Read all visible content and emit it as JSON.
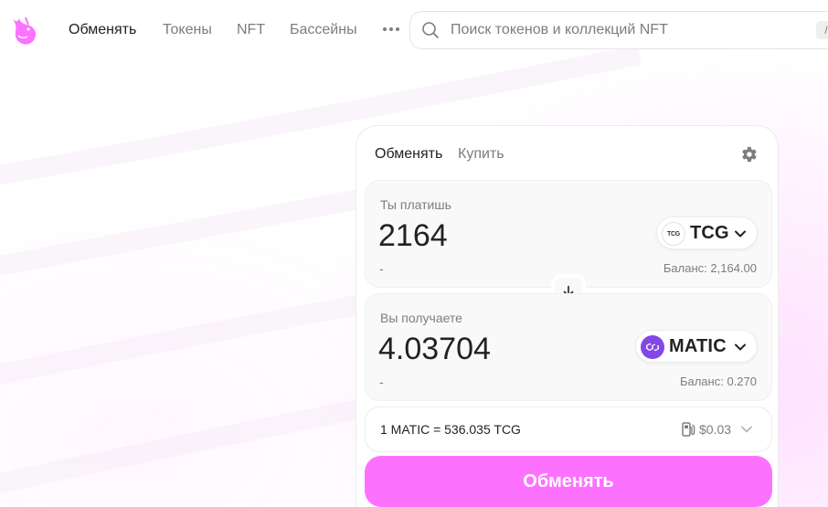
{
  "colors": {
    "accent": "#fc72ff",
    "text_primary": "#222222",
    "text_secondary": "#7d7d7d",
    "panel_bg": "#f9f9f9",
    "matic_purple": "#8247e5"
  },
  "nav": {
    "logo_icon": "unicorn-logo-icon",
    "links": [
      "Обменять",
      "Токены",
      "NFT",
      "Бассейны"
    ],
    "active_link": "Обменять",
    "more_icon": "more-dots-icon",
    "search": {
      "icon": "search-icon",
      "placeholder": "Поиск токенов и коллекций NFT",
      "value": ""
    }
  },
  "swap": {
    "tabs": [
      "Обменять",
      "Купить"
    ],
    "active_tab": "Обменять",
    "settings_icon": "gear-icon",
    "pay": {
      "label": "Ты платишь",
      "amount": "2164",
      "usd_value": "-",
      "token": {
        "symbol": "TCG",
        "logo_text": "TCG"
      },
      "balance_label": "Баланс:",
      "balance_value": "2,164.00"
    },
    "switch_icon": "arrow-down-icon",
    "receive": {
      "label": "Вы получаете",
      "amount": "4.03704",
      "usd_value": "-",
      "token": {
        "symbol": "MATIC"
      },
      "balance_label": "Баланс:",
      "balance_value": "0.270"
    },
    "rate": {
      "text": "1 MATIC = 536.035 TCG",
      "gas_icon": "gas-pump-icon",
      "gas_fee": "$0.03"
    },
    "submit_label": "Обменять"
  }
}
